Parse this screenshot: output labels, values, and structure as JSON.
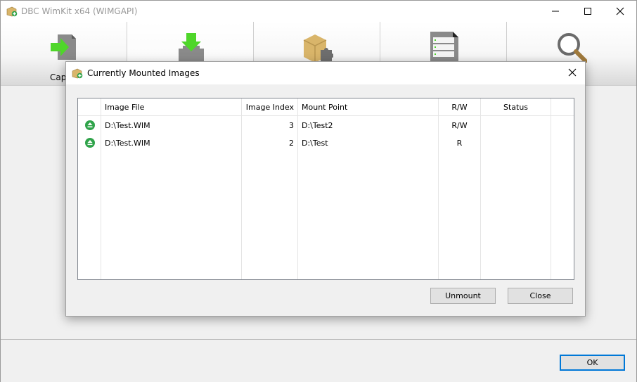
{
  "window": {
    "title": "DBC WimKit x64 (WIMGAPI)",
    "controls": {
      "minimize": "—",
      "maximize": "☐",
      "close": "✕"
    }
  },
  "toolbar": {
    "buttons": [
      {
        "label": "Capt",
        "icon": "capture-arrow-icon"
      },
      {
        "label": "",
        "icon": "apply-download-icon"
      },
      {
        "label": "",
        "icon": "package-puzzle-icon"
      },
      {
        "label": "",
        "icon": "document-list-icon"
      },
      {
        "label": "",
        "icon": "magnifier-icon"
      }
    ]
  },
  "footer": {
    "ok_label": "OK"
  },
  "dialog": {
    "title": "Currently Mounted Images",
    "close_glyph": "✕",
    "columns": {
      "image_file": "Image File",
      "image_index": "Image Index",
      "mount_point": "Mount Point",
      "rw": "R/W",
      "status": "Status"
    },
    "rows": [
      {
        "image_file": "D:\\Test.WIM",
        "image_index": "3",
        "mount_point": "D:\\Test2",
        "rw": "R/W",
        "status": ""
      },
      {
        "image_file": "D:\\Test.WIM",
        "image_index": "2",
        "mount_point": "D:\\Test",
        "rw": "R",
        "status": ""
      }
    ],
    "unmount_label": "Unmount",
    "close_label": "Close"
  },
  "colors": {
    "accent_green": "#2fa34a",
    "default_button_border": "#0078d7"
  }
}
